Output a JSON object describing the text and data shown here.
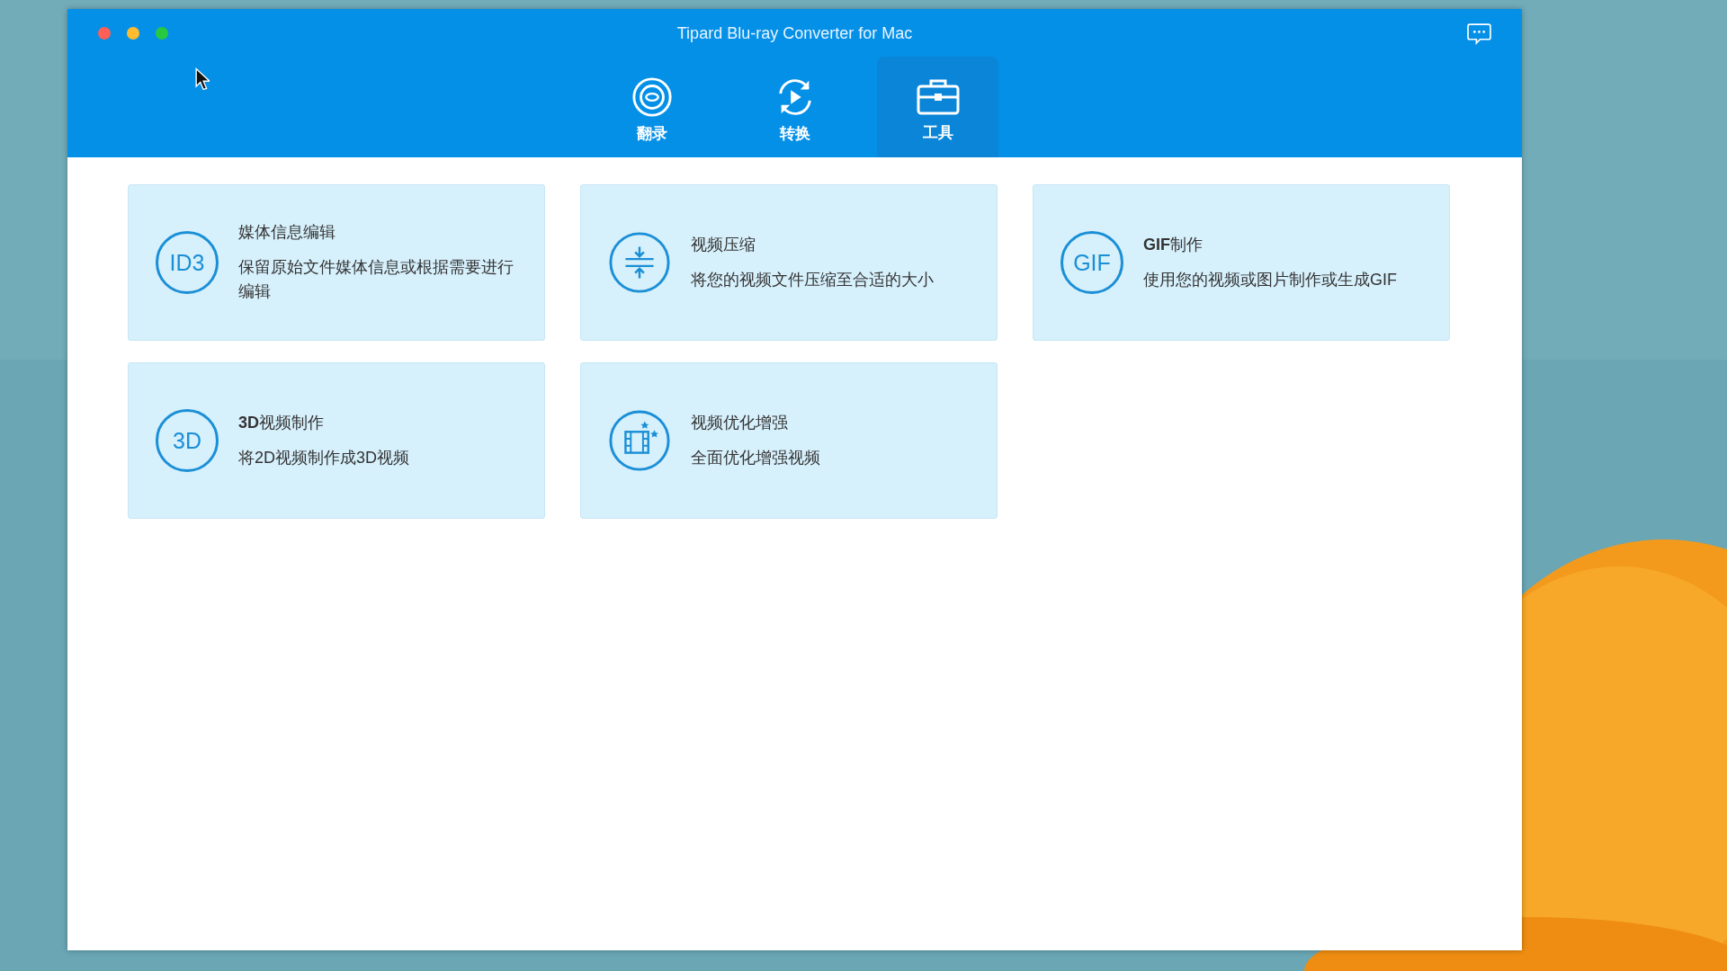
{
  "window": {
    "title": "Tipard Blu-ray Converter for Mac"
  },
  "tabs": [
    {
      "label": "翻录",
      "kind": "disc",
      "selected": false
    },
    {
      "label": "转换",
      "kind": "convert",
      "selected": false
    },
    {
      "label": "工具",
      "kind": "toolbox",
      "selected": true
    }
  ],
  "tools": [
    {
      "kind": "text",
      "icon_text": "ID3",
      "title": "媒体信息编辑",
      "description": "保留原始文件媒体信息或根据需要进行编辑"
    },
    {
      "kind": "compress",
      "title": "视频压缩",
      "description": "将您的视频文件压缩至合适的大小"
    },
    {
      "kind": "text",
      "icon_text": "GIF",
      "title": "**GIF**制作",
      "description": "使用您的视频或图片制作或生成GIF"
    },
    {
      "kind": "text",
      "icon_text": "3D",
      "title": "**3D**视频制作",
      "description": "将2D视频制作成3D视频"
    },
    {
      "kind": "enhance",
      "title": "视频优化增强",
      "description": "全面优化增强视频"
    }
  ]
}
